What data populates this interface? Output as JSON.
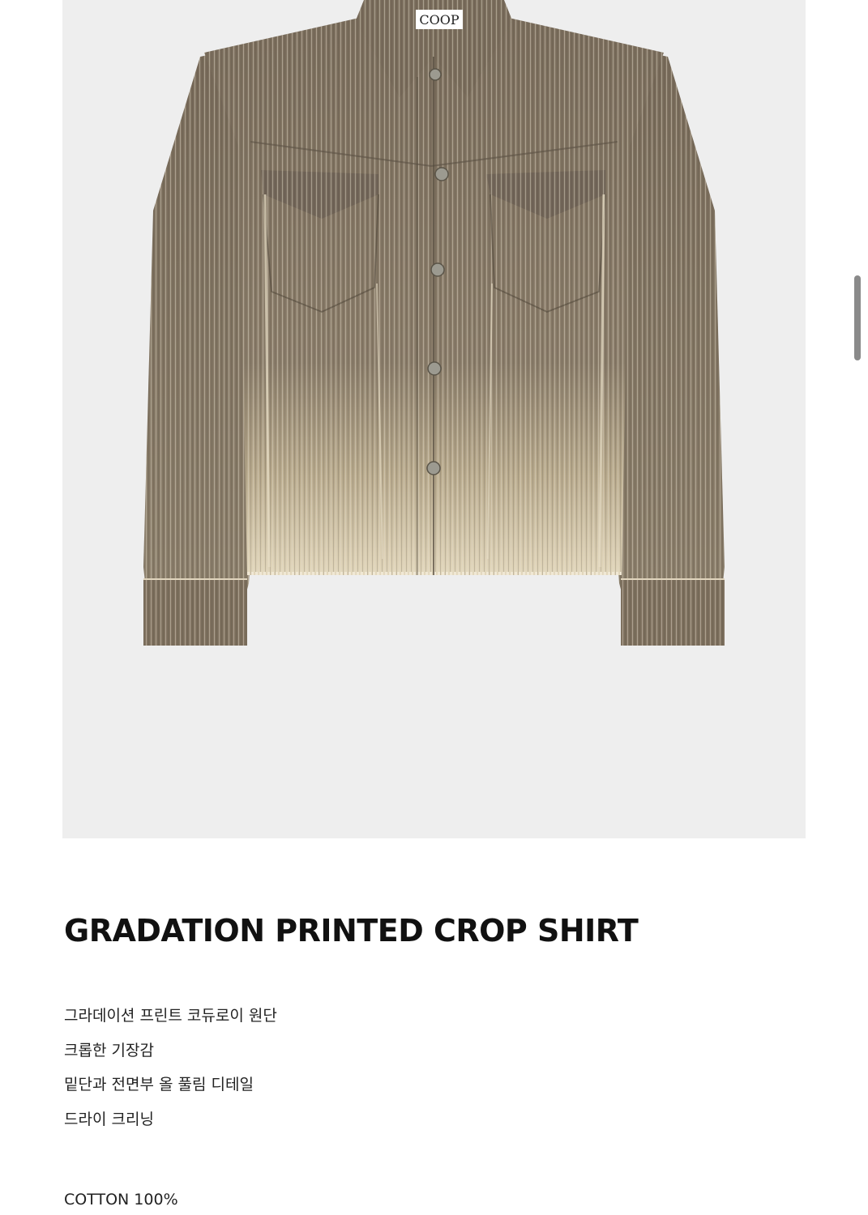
{
  "product": {
    "image_label": "COOP",
    "title": "GRADATION PRINTED CROP SHIRT",
    "description": [
      "그라데이션 프린트 코듀로이 원단",
      "크롭한 기장감",
      "밑단과 전면부 올 풀림 디테일",
      "드라이 크리닝"
    ],
    "material": "COTTON 100%"
  },
  "colors": {
    "image_bg": "#eeeeee",
    "shirt_dark": "#7a6d5c",
    "shirt_light": "#d8cdb2",
    "text": "#111111"
  }
}
